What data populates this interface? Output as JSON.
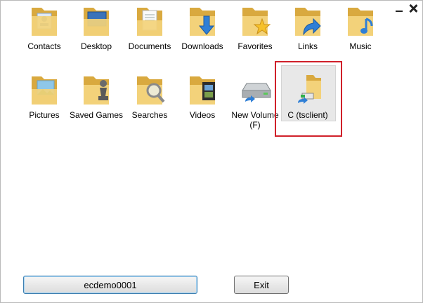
{
  "window": {
    "controls": [
      "minimize-icon",
      "close-icon"
    ]
  },
  "tiles": [
    {
      "label": "Contacts",
      "icon": "contacts-folder-icon"
    },
    {
      "label": "Desktop",
      "icon": "desktop-folder-icon"
    },
    {
      "label": "Documents",
      "icon": "documents-folder-icon"
    },
    {
      "label": "Downloads",
      "icon": "downloads-folder-icon"
    },
    {
      "label": "Favorites",
      "icon": "favorites-folder-icon"
    },
    {
      "label": "Links",
      "icon": "links-folder-icon"
    },
    {
      "label": "Music",
      "icon": "music-folder-icon"
    },
    {
      "label": "Pictures",
      "icon": "pictures-folder-icon"
    },
    {
      "label": "Saved Games",
      "icon": "saved-games-folder-icon"
    },
    {
      "label": "Searches",
      "icon": "searches-folder-icon"
    },
    {
      "label": "Videos",
      "icon": "videos-folder-icon"
    },
    {
      "label": "New Volume (F)",
      "icon": "drive-icon"
    },
    {
      "label": "C (tsclient)",
      "icon": "network-folder-icon",
      "selected": true
    }
  ],
  "footer": {
    "user_label": "ecdemo0001",
    "exit_label": "Exit"
  },
  "colors": {
    "folder": "#f3d27a",
    "folder_dark": "#d9a93f",
    "selection_border": "#d0202a",
    "button_border_focus": "#3c7fb1"
  }
}
